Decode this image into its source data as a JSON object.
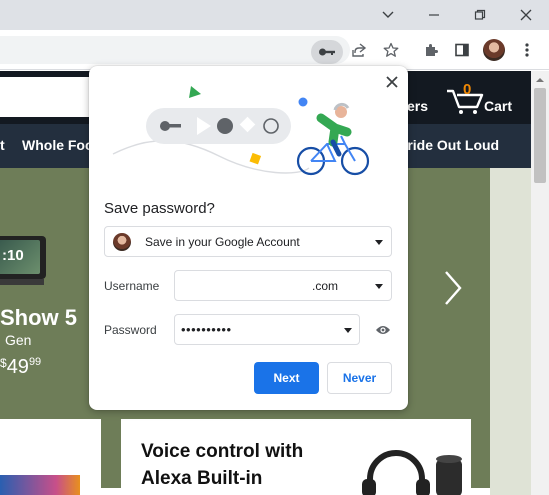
{
  "window": {
    "controls": [
      "minimize",
      "restore",
      "close"
    ]
  },
  "toolbar": {
    "icons": [
      "key-icon",
      "share-icon",
      "star-icon",
      "extensions-icon",
      "side-panel-icon",
      "profile-avatar",
      "kebab-menu-icon"
    ]
  },
  "amazon": {
    "header_right": "ers",
    "cart_count": "0",
    "cart_label": "Cart",
    "nav_left_fragment": "t",
    "nav_whole_foods": "Whole Foo",
    "nav_pride": "Pride Out Loud",
    "device_screen_text": ":10",
    "product_title": "Show 5",
    "product_subtitle": "Gen",
    "price_symbol": "$",
    "price_whole": "49",
    "price_cents": "99",
    "card_heading_line1": "Voice control with",
    "card_heading_line2": "Alexa Built-in",
    "accent_color": "#febd69"
  },
  "dialog": {
    "title": "Save password?",
    "account_option": "Save in your Google Account",
    "username_label": "Username",
    "username_value": ".com",
    "password_label": "Password",
    "password_value": "••••••••••",
    "primary_button": "Next",
    "secondary_button": "Never",
    "accent_color": "#1a73e8"
  }
}
